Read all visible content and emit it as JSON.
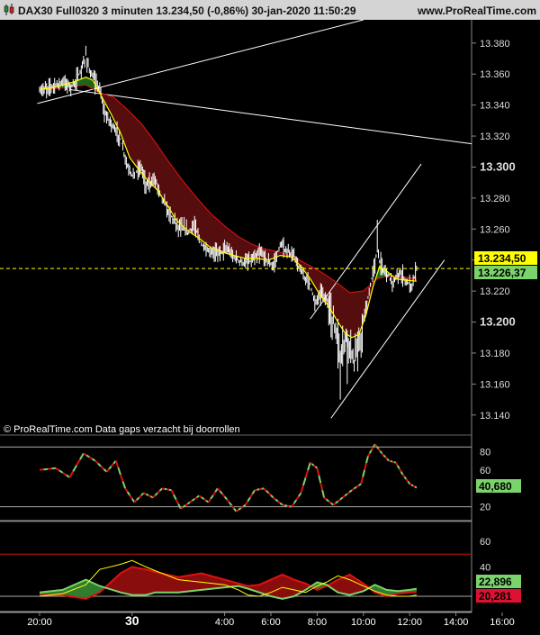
{
  "header": {
    "title": "DAX30 Full0320 3 minuten 13.234,50 (-0,86%) 30-jan-2020 11:50:29",
    "site": "www.ProRealTime.com"
  },
  "footer_note": "© ProRealTime.com  Data gaps verzacht bij doorrollen",
  "colors": {
    "background": "#000000",
    "price": "#ffffff",
    "fast_ma": "#ffff00",
    "slow_ma": "#cc1111",
    "cloud_bear": "#5a0e0e",
    "cloud_bull": "#1b6b1b",
    "rsi_up": "#7bd36b",
    "rsi_down": "#dd1111",
    "last_price_bg": "#ffff00",
    "ma_label_bg": "#7bd36b",
    "red_label_bg": "#dd1133"
  },
  "chart_data": [
    {
      "panel": "price",
      "type": "line",
      "title": "DAX30 Full0320 3 minuten",
      "ylim": [
        13130,
        13395
      ],
      "y_ticks": [
        13140,
        13160,
        13180,
        13200,
        13220,
        13240,
        13260,
        13280,
        13300,
        13320,
        13340,
        13360,
        13380
      ],
      "y_tick_labels": [
        "13.140",
        "13.160",
        "13.180",
        "13.200",
        "13.220",
        "13.240",
        "13.260",
        "13.280",
        "13.300",
        "13.320",
        "13.340",
        "13.360",
        "13.380"
      ],
      "y_bold_ticks": [
        13200,
        13300
      ],
      "last_price": 13234.5,
      "last_price_label": "13.234,50",
      "ma_value": 13226.37,
      "ma_label": "13.226,37",
      "x_ticks": [
        {
          "label": "20:00",
          "hour": 20
        },
        {
          "label": "30",
          "hour": 24,
          "bold": true
        },
        {
          "label": "4:00",
          "hour": 28
        },
        {
          "label": "6:00",
          "hour": 30
        },
        {
          "label": "8:00",
          "hour": 32
        },
        {
          "label": "10:00",
          "hour": 34
        },
        {
          "label": "12:00",
          "hour": 36
        },
        {
          "label": "14:00",
          "hour": 38
        },
        {
          "label": "16:00",
          "hour": 40
        }
      ],
      "price_series": [
        [
          20.0,
          13349
        ],
        [
          20.5,
          13352
        ],
        [
          21.0,
          13355
        ],
        [
          21.4,
          13352
        ],
        [
          21.8,
          13362
        ],
        [
          22.0,
          13372
        ],
        [
          22.2,
          13360
        ],
        [
          22.6,
          13350
        ],
        [
          22.8,
          13335
        ],
        [
          23.1,
          13328
        ],
        [
          23.5,
          13318
        ],
        [
          23.8,
          13300
        ],
        [
          24.0,
          13295
        ],
        [
          24.4,
          13300
        ],
        [
          24.6,
          13288
        ],
        [
          25.0,
          13292
        ],
        [
          25.3,
          13280
        ],
        [
          25.6,
          13270
        ],
        [
          26.0,
          13262
        ],
        [
          26.4,
          13258
        ],
        [
          26.7,
          13262
        ],
        [
          27.0,
          13250
        ],
        [
          27.3,
          13245
        ],
        [
          27.7,
          13245
        ],
        [
          28.1,
          13247
        ],
        [
          28.4,
          13242
        ],
        [
          28.8,
          13238
        ],
        [
          29.2,
          13240
        ],
        [
          29.6,
          13245
        ],
        [
          29.9,
          13238
        ],
        [
          30.1,
          13236
        ],
        [
          30.4,
          13250
        ],
        [
          30.7,
          13245
        ],
        [
          31.0,
          13243
        ],
        [
          31.3,
          13232
        ],
        [
          31.7,
          13225
        ],
        [
          31.9,
          13212
        ],
        [
          32.2,
          13220
        ],
        [
          32.5,
          13210
        ],
        [
          32.8,
          13195
        ],
        [
          33.0,
          13180
        ],
        [
          33.3,
          13192
        ],
        [
          33.6,
          13175
        ],
        [
          33.9,
          13188
        ],
        [
          34.0,
          13200
        ],
        [
          34.2,
          13215
        ],
        [
          34.4,
          13232
        ],
        [
          34.6,
          13245
        ],
        [
          34.8,
          13235
        ],
        [
          35.0,
          13232
        ],
        [
          35.3,
          13225
        ],
        [
          35.6,
          13232
        ],
        [
          35.9,
          13225
        ],
        [
          36.1,
          13224
        ],
        [
          36.3,
          13234.5
        ]
      ],
      "fast_ma_series": [
        [
          20.0,
          13350
        ],
        [
          20.5,
          13351
        ],
        [
          21.0,
          13353
        ],
        [
          21.5,
          13355
        ],
        [
          22.0,
          13358
        ],
        [
          22.3,
          13356
        ],
        [
          22.7,
          13345
        ],
        [
          23.1,
          13334
        ],
        [
          23.5,
          13322
        ],
        [
          23.9,
          13306
        ],
        [
          24.3,
          13298
        ],
        [
          24.7,
          13291
        ],
        [
          25.1,
          13285
        ],
        [
          25.5,
          13276
        ],
        [
          25.9,
          13266
        ],
        [
          26.4,
          13259
        ],
        [
          26.9,
          13254
        ],
        [
          27.4,
          13248
        ],
        [
          27.9,
          13245
        ],
        [
          28.4,
          13243
        ],
        [
          28.9,
          13241
        ],
        [
          29.4,
          13241
        ],
        [
          29.9,
          13240
        ],
        [
          30.4,
          13243
        ],
        [
          30.9,
          13242
        ],
        [
          31.3,
          13236
        ],
        [
          31.7,
          13228
        ],
        [
          32.1,
          13218
        ],
        [
          32.5,
          13210
        ],
        [
          32.9,
          13200
        ],
        [
          33.2,
          13193
        ],
        [
          33.5,
          13190
        ],
        [
          33.8,
          13192
        ],
        [
          34.1,
          13204
        ],
        [
          34.4,
          13222
        ],
        [
          34.7,
          13236
        ],
        [
          35.0,
          13233
        ],
        [
          35.4,
          13228
        ],
        [
          35.8,
          13227
        ],
        [
          36.3,
          13226.37
        ]
      ],
      "slow_ma_series": [
        [
          20.0,
          13350
        ],
        [
          21.0,
          13351
        ],
        [
          22.0,
          13353
        ],
        [
          22.6,
          13348
        ],
        [
          23.2,
          13345
        ],
        [
          23.8,
          13337
        ],
        [
          24.4,
          13328
        ],
        [
          25.0,
          13316
        ],
        [
          25.6,
          13303
        ],
        [
          26.2,
          13291
        ],
        [
          26.8,
          13280
        ],
        [
          27.4,
          13270
        ],
        [
          28.0,
          13262
        ],
        [
          28.6,
          13255
        ],
        [
          29.2,
          13250
        ],
        [
          29.8,
          13247
        ],
        [
          30.4,
          13245
        ],
        [
          31.0,
          13242
        ],
        [
          31.6,
          13237
        ],
        [
          32.2,
          13232
        ],
        [
          32.8,
          13226
        ],
        [
          33.4,
          13219
        ],
        [
          34.0,
          13220
        ],
        [
          34.6,
          13228
        ],
        [
          35.2,
          13230
        ],
        [
          35.8,
          13229
        ],
        [
          36.3,
          13228
        ]
      ],
      "trend_lines": [
        {
          "kind": "upper-trend",
          "points": [
            [
              19.9,
              13341
            ],
            [
              34.0,
              13395
            ]
          ]
        },
        {
          "kind": "resistance",
          "points": [
            [
              21.3,
              13350
            ],
            [
              40.0,
              13315
            ]
          ]
        },
        {
          "kind": "channel-support",
          "points": [
            [
              32.6,
              13138
            ],
            [
              37.5,
              13240
            ]
          ]
        },
        {
          "kind": "channel-upper",
          "points": [
            [
              31.7,
              13202
            ],
            [
              36.5,
              13302
            ]
          ]
        }
      ]
    },
    {
      "panel": "oscillator-1",
      "type": "line",
      "ylim": [
        5,
        95
      ],
      "y_tick_labels": [
        "80",
        "60",
        "20"
      ],
      "levels": [
        85,
        20,
        5
      ],
      "value": 40.68,
      "value_label": "40,680",
      "series": [
        [
          20,
          60
        ],
        [
          20.7,
          62
        ],
        [
          21.3,
          52
        ],
        [
          21.9,
          78
        ],
        [
          22.4,
          70
        ],
        [
          22.9,
          58
        ],
        [
          23.3,
          70
        ],
        [
          23.7,
          40
        ],
        [
          24.1,
          25
        ],
        [
          24.5,
          35
        ],
        [
          24.9,
          30
        ],
        [
          25.3,
          40
        ],
        [
          25.7,
          38
        ],
        [
          26.1,
          18
        ],
        [
          26.5,
          25
        ],
        [
          26.9,
          32
        ],
        [
          27.3,
          25
        ],
        [
          27.7,
          40
        ],
        [
          28.1,
          28
        ],
        [
          28.5,
          15
        ],
        [
          28.9,
          22
        ],
        [
          29.3,
          38
        ],
        [
          29.7,
          40
        ],
        [
          30.1,
          30
        ],
        [
          30.5,
          22
        ],
        [
          30.9,
          20
        ],
        [
          31.3,
          35
        ],
        [
          31.7,
          68
        ],
        [
          32.0,
          62
        ],
        [
          32.3,
          30
        ],
        [
          32.7,
          22
        ],
        [
          33.1,
          30
        ],
        [
          33.5,
          38
        ],
        [
          33.9,
          45
        ],
        [
          34.2,
          75
        ],
        [
          34.5,
          88
        ],
        [
          34.8,
          78
        ],
        [
          35.1,
          70
        ],
        [
          35.4,
          68
        ],
        [
          35.7,
          55
        ],
        [
          36.0,
          45
        ],
        [
          36.3,
          40.68
        ]
      ]
    },
    {
      "panel": "oscillator-2",
      "type": "area",
      "ylim": [
        5,
        72
      ],
      "y_tick_labels": [
        "60",
        "40"
      ],
      "levels": [
        50,
        17,
        5
      ],
      "values": {
        "up": 22.896,
        "down": 20.281
      },
      "value_labels": {
        "up": "22,896",
        "down": "20,281"
      },
      "plus_series": [
        [
          20,
          20
        ],
        [
          21,
          22
        ],
        [
          22,
          30
        ],
        [
          22.6,
          25
        ],
        [
          23.5,
          20
        ],
        [
          24,
          18
        ],
        [
          24.6,
          18
        ],
        [
          25,
          20
        ],
        [
          26,
          20
        ],
        [
          27,
          22
        ],
        [
          28,
          24
        ],
        [
          28.6,
          25
        ],
        [
          29,
          23
        ],
        [
          29.5,
          20
        ],
        [
          30,
          17
        ],
        [
          30.5,
          15
        ],
        [
          31,
          17
        ],
        [
          31.5,
          22
        ],
        [
          32,
          28
        ],
        [
          32.4,
          26
        ],
        [
          32.9,
          20
        ],
        [
          33.4,
          18
        ],
        [
          34,
          21
        ],
        [
          34.5,
          26
        ],
        [
          35,
          22
        ],
        [
          35.5,
          21
        ],
        [
          36,
          22
        ],
        [
          36.3,
          22.896
        ]
      ],
      "minus_series": [
        [
          20,
          18
        ],
        [
          21,
          18
        ],
        [
          22,
          15
        ],
        [
          22.6,
          20
        ],
        [
          23.5,
          35
        ],
        [
          24,
          40
        ],
        [
          24.6,
          38
        ],
        [
          25,
          36
        ],
        [
          26,
          32
        ],
        [
          27,
          35
        ],
        [
          28,
          30
        ],
        [
          28.6,
          27
        ],
        [
          29,
          25
        ],
        [
          29.5,
          26
        ],
        [
          30,
          30
        ],
        [
          30.5,
          34
        ],
        [
          31,
          30
        ],
        [
          31.5,
          27
        ],
        [
          32,
          22
        ],
        [
          32.4,
          25
        ],
        [
          32.9,
          30
        ],
        [
          33.4,
          34
        ],
        [
          34,
          27
        ],
        [
          34.5,
          20
        ],
        [
          35,
          17
        ],
        [
          35.5,
          19
        ],
        [
          36,
          20
        ],
        [
          36.3,
          20.281
        ]
      ],
      "yellow_series": [
        [
          20,
          17
        ],
        [
          21,
          19
        ],
        [
          22,
          26
        ],
        [
          22.6,
          38
        ],
        [
          23.5,
          42
        ],
        [
          24,
          45
        ],
        [
          24.6,
          40
        ],
        [
          25,
          37
        ],
        [
          26,
          30
        ],
        [
          27,
          28
        ],
        [
          28,
          26
        ],
        [
          28.6,
          22
        ],
        [
          29,
          18
        ],
        [
          29.5,
          17
        ],
        [
          30,
          20
        ],
        [
          30.5,
          24
        ],
        [
          31,
          22
        ],
        [
          31.5,
          20
        ],
        [
          32,
          25
        ],
        [
          32.4,
          28
        ],
        [
          32.9,
          33
        ],
        [
          33.4,
          30
        ],
        [
          34,
          25
        ],
        [
          34.5,
          21
        ],
        [
          35,
          18
        ],
        [
          35.5,
          17
        ],
        [
          36,
          17
        ],
        [
          36.3,
          18
        ]
      ]
    }
  ]
}
